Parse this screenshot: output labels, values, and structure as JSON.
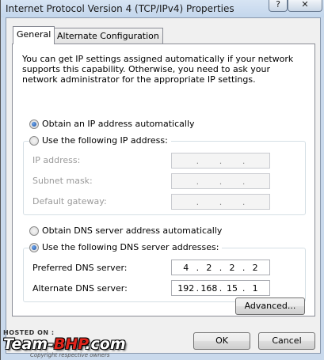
{
  "window": {
    "title": "Internet Protocol Version 4 (TCP/IPv4) Properties",
    "help_glyph": "?",
    "close_glyph": "✕"
  },
  "tabs": [
    {
      "label": "General",
      "active": true
    },
    {
      "label": "Alternate Configuration",
      "active": false
    }
  ],
  "intro_text": "You can get IP settings assigned automatically if your network supports this capability. Otherwise, you need to ask your network administrator for the appropriate IP settings.",
  "ip_section": {
    "auto_label": "Obtain an IP address automatically",
    "auto_checked": true,
    "manual_label": "Use the following IP address:",
    "manual_checked": false,
    "fields": [
      {
        "label": "IP address:",
        "value": [
          "",
          "",
          "",
          ""
        ],
        "enabled": false
      },
      {
        "label": "Subnet mask:",
        "value": [
          "",
          "",
          "",
          ""
        ],
        "enabled": false
      },
      {
        "label": "Default gateway:",
        "value": [
          "",
          "",
          "",
          ""
        ],
        "enabled": false
      }
    ]
  },
  "dns_section": {
    "auto_label": "Obtain DNS server address automatically",
    "auto_checked": false,
    "manual_label": "Use the following DNS server addresses:",
    "manual_checked": true,
    "fields": [
      {
        "label": "Preferred DNS server:",
        "value": [
          "4",
          "2",
          "2",
          "2"
        ],
        "enabled": true
      },
      {
        "label": "Alternate DNS server:",
        "value": [
          "192",
          "168",
          "15",
          "1"
        ],
        "enabled": true
      }
    ]
  },
  "buttons": {
    "advanced": "Advanced...",
    "ok": "OK",
    "cancel": "Cancel"
  },
  "watermark": {
    "hosted_on": "HOSTED ON :",
    "brand_part1": "Team-",
    "brand_part2": "BHP",
    "brand_part3": ".com",
    "tagline": "Copyright respective owners"
  }
}
